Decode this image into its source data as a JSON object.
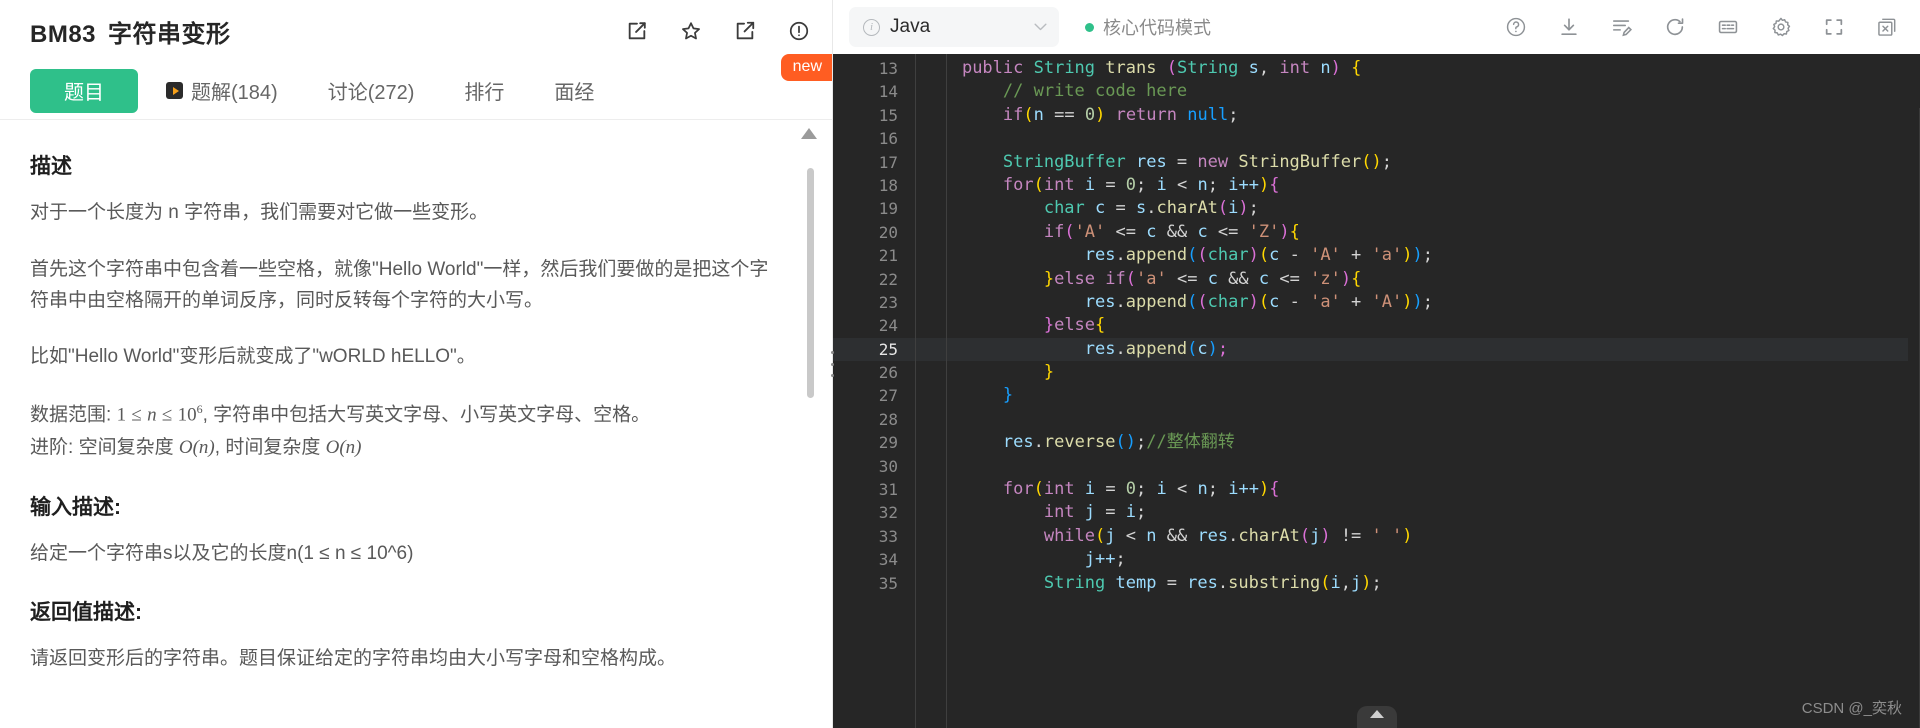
{
  "problem": {
    "code": "BM83",
    "title": "字符串变形",
    "header_icons": [
      "edit-icon",
      "star-icon",
      "share-icon",
      "info-icon"
    ],
    "new_badge": "new"
  },
  "tabs": [
    {
      "label": "题目",
      "active": true
    },
    {
      "label": "题解(184)",
      "active": false,
      "icon": "play-icon"
    },
    {
      "label": "讨论(272)",
      "active": false
    },
    {
      "label": "排行",
      "active": false
    },
    {
      "label": "面经",
      "active": false
    }
  ],
  "description": {
    "heading": "描述",
    "p1": "对于一个长度为 n 字符串，我们需要对它做一些变形。",
    "p2": "首先这个字符串中包含着一些空格，就像\"Hello World\"一样，然后我们要做的是把这个字符串中由空格隔开的单词反序，同时反转每个字符的大小写。",
    "p3": "比如\"Hello World\"变形后就变成了\"wORLD hELLO\"。",
    "range_prefix": "数据范围:",
    "range_math_lhs": "1",
    "range_le1": "≤",
    "range_var": "n",
    "range_le2": "≤",
    "range_base": "10",
    "range_exp": "6",
    "range_suffix": ", 字符串中包括大写英文字母、小写英文字母、空格。",
    "advanced_prefix": "进阶:",
    "advanced_space_label": "空间复杂度",
    "advanced_space_val": "O(n)",
    "advanced_time_label": "时间复杂度",
    "advanced_time_val": "O(n)",
    "input_heading": "输入描述:",
    "input_text": "给定一个字符串s以及它的长度n(1 ≤ n ≤ 10^6)",
    "return_heading": "返回值描述:",
    "return_text": "请返回变形后的字符串。题目保证给定的字符串均由大小写字母和空格构成。"
  },
  "editor": {
    "language": "Java",
    "language_info_icon": "info-icon",
    "dropdown_icon": "chevron-down-icon",
    "mode_label": "核心代码模式",
    "mode_dot_color": "#2fc08a",
    "toolbar_icons": [
      "help-icon",
      "download-icon",
      "note-edit-icon",
      "refresh-icon",
      "console-icon",
      "settings-gear-icon",
      "fullscreen-icon",
      "close-window-icon"
    ],
    "watermark": "CSDN @_奕秋",
    "active_line": 25,
    "first_line": 13,
    "lines": [
      {
        "n": 13,
        "tokens": [
          {
            "t": "public ",
            "c": "kw"
          },
          {
            "t": "String",
            "c": "type"
          },
          {
            "t": " ",
            "c": "op"
          },
          {
            "t": "trans ",
            "c": "fn"
          },
          {
            "t": "(",
            "c": "p2"
          },
          {
            "t": "String",
            "c": "type"
          },
          {
            "t": " ",
            "c": "op"
          },
          {
            "t": "s",
            "c": "var"
          },
          {
            "t": ", ",
            "c": "op"
          },
          {
            "t": "int",
            "c": "kw"
          },
          {
            "t": " ",
            "c": "op"
          },
          {
            "t": "n",
            "c": "var"
          },
          {
            "t": ")",
            "c": "p2"
          },
          {
            "t": " ",
            "c": "op"
          },
          {
            "t": "{",
            "c": "pl"
          }
        ],
        "indent": 1
      },
      {
        "n": 14,
        "tokens": [
          {
            "t": "// write code here",
            "c": "cmt"
          }
        ],
        "indent": 2
      },
      {
        "n": 15,
        "tokens": [
          {
            "t": "if",
            "c": "kw"
          },
          {
            "t": "(",
            "c": "pl"
          },
          {
            "t": "n ",
            "c": "var"
          },
          {
            "t": "== ",
            "c": "op"
          },
          {
            "t": "0",
            "c": "num"
          },
          {
            "t": ")",
            "c": "pl"
          },
          {
            "t": " ",
            "c": "op"
          },
          {
            "t": "return",
            "c": "kw"
          },
          {
            "t": " ",
            "c": "op"
          },
          {
            "t": "null",
            "c": "p3"
          },
          {
            "t": ";",
            "c": "op"
          }
        ],
        "indent": 2
      },
      {
        "n": 16,
        "tokens": [],
        "indent": 2
      },
      {
        "n": 17,
        "tokens": [
          {
            "t": "StringBuffer",
            "c": "type"
          },
          {
            "t": " ",
            "c": "op"
          },
          {
            "t": "res ",
            "c": "var"
          },
          {
            "t": "= ",
            "c": "op"
          },
          {
            "t": "new",
            "c": "kw"
          },
          {
            "t": " ",
            "c": "op"
          },
          {
            "t": "StringBuffer",
            "c": "fn"
          },
          {
            "t": "(",
            "c": "pl"
          },
          {
            "t": ")",
            "c": "pl"
          },
          {
            "t": ";",
            "c": "op"
          }
        ],
        "indent": 2
      },
      {
        "n": 18,
        "tokens": [
          {
            "t": "for",
            "c": "kw"
          },
          {
            "t": "(",
            "c": "pl"
          },
          {
            "t": "int",
            "c": "kw"
          },
          {
            "t": " ",
            "c": "op"
          },
          {
            "t": "i ",
            "c": "var"
          },
          {
            "t": "= ",
            "c": "op"
          },
          {
            "t": "0",
            "c": "num"
          },
          {
            "t": "; ",
            "c": "op"
          },
          {
            "t": "i ",
            "c": "var"
          },
          {
            "t": "< ",
            "c": "op"
          },
          {
            "t": "n",
            "c": "var"
          },
          {
            "t": "; ",
            "c": "op"
          },
          {
            "t": "i++",
            "c": "var"
          },
          {
            "t": ")",
            "c": "pl"
          },
          {
            "t": "{",
            "c": "p2"
          }
        ],
        "indent": 2
      },
      {
        "n": 19,
        "tokens": [
          {
            "t": "char",
            "c": "type"
          },
          {
            "t": " ",
            "c": "op"
          },
          {
            "t": "c ",
            "c": "var"
          },
          {
            "t": "= ",
            "c": "op"
          },
          {
            "t": "s",
            "c": "var"
          },
          {
            "t": ".",
            "c": "op"
          },
          {
            "t": "charAt",
            "c": "fn"
          },
          {
            "t": "(",
            "c": "p2"
          },
          {
            "t": "i",
            "c": "var"
          },
          {
            "t": ")",
            "c": "p2"
          },
          {
            "t": ";",
            "c": "op"
          }
        ],
        "indent": 3
      },
      {
        "n": 20,
        "tokens": [
          {
            "t": "if",
            "c": "kw"
          },
          {
            "t": "(",
            "c": "p2"
          },
          {
            "t": "'A'",
            "c": "str"
          },
          {
            "t": " <= ",
            "c": "op"
          },
          {
            "t": "c ",
            "c": "var"
          },
          {
            "t": "&& ",
            "c": "op"
          },
          {
            "t": "c ",
            "c": "var"
          },
          {
            "t": "<= ",
            "c": "op"
          },
          {
            "t": "'Z'",
            "c": "str"
          },
          {
            "t": ")",
            "c": "p2"
          },
          {
            "t": "{",
            "c": "pl"
          }
        ],
        "indent": 3
      },
      {
        "n": 21,
        "tokens": [
          {
            "t": "res",
            "c": "var"
          },
          {
            "t": ".",
            "c": "op"
          },
          {
            "t": "append",
            "c": "fn"
          },
          {
            "t": "(",
            "c": "p3"
          },
          {
            "t": "(",
            "c": "p2"
          },
          {
            "t": "char",
            "c": "type"
          },
          {
            "t": ")",
            "c": "p2"
          },
          {
            "t": "(",
            "c": "pl"
          },
          {
            "t": "c ",
            "c": "var"
          },
          {
            "t": "- ",
            "c": "op"
          },
          {
            "t": "'A'",
            "c": "str"
          },
          {
            "t": " + ",
            "c": "op"
          },
          {
            "t": "'a'",
            "c": "str"
          },
          {
            "t": ")",
            "c": "pl"
          },
          {
            "t": ")",
            "c": "p3"
          },
          {
            "t": ";",
            "c": "op"
          }
        ],
        "indent": 4
      },
      {
        "n": 22,
        "tokens": [
          {
            "t": "}",
            "c": "pl"
          },
          {
            "t": "else",
            "c": "kw"
          },
          {
            "t": " ",
            "c": "op"
          },
          {
            "t": "if",
            "c": "kw"
          },
          {
            "t": "(",
            "c": "p2"
          },
          {
            "t": "'a'",
            "c": "str"
          },
          {
            "t": " <= ",
            "c": "op"
          },
          {
            "t": "c ",
            "c": "var"
          },
          {
            "t": "&& ",
            "c": "op"
          },
          {
            "t": "c ",
            "c": "var"
          },
          {
            "t": "<= ",
            "c": "op"
          },
          {
            "t": "'z'",
            "c": "str"
          },
          {
            "t": ")",
            "c": "p2"
          },
          {
            "t": "{",
            "c": "pl"
          }
        ],
        "indent": 3
      },
      {
        "n": 23,
        "tokens": [
          {
            "t": "res",
            "c": "var"
          },
          {
            "t": ".",
            "c": "op"
          },
          {
            "t": "append",
            "c": "fn"
          },
          {
            "t": "(",
            "c": "p3"
          },
          {
            "t": "(",
            "c": "p2"
          },
          {
            "t": "char",
            "c": "type"
          },
          {
            "t": ")",
            "c": "p2"
          },
          {
            "t": "(",
            "c": "pl"
          },
          {
            "t": "c ",
            "c": "var"
          },
          {
            "t": "- ",
            "c": "op"
          },
          {
            "t": "'a'",
            "c": "str"
          },
          {
            "t": " + ",
            "c": "op"
          },
          {
            "t": "'A'",
            "c": "str"
          },
          {
            "t": ")",
            "c": "pl"
          },
          {
            "t": ")",
            "c": "p3"
          },
          {
            "t": ";",
            "c": "op"
          }
        ],
        "indent": 4
      },
      {
        "n": 24,
        "tokens": [
          {
            "t": "}",
            "c": "p2"
          },
          {
            "t": "else",
            "c": "kw"
          },
          {
            "t": "{",
            "c": "pl"
          }
        ],
        "indent": 3
      },
      {
        "n": 25,
        "tokens": [
          {
            "t": "res",
            "c": "var"
          },
          {
            "t": ".",
            "c": "op"
          },
          {
            "t": "append",
            "c": "fn"
          },
          {
            "t": "(",
            "c": "p3"
          },
          {
            "t": "c",
            "c": "var"
          },
          {
            "t": ")",
            "c": "p3"
          },
          {
            "t": ";",
            "c": "p2"
          }
        ],
        "indent": 4
      },
      {
        "n": 26,
        "tokens": [
          {
            "t": "}",
            "c": "pl"
          }
        ],
        "indent": 3
      },
      {
        "n": 27,
        "tokens": [
          {
            "t": "}",
            "c": "p3"
          }
        ],
        "indent": 2
      },
      {
        "n": 28,
        "tokens": [],
        "indent": 2
      },
      {
        "n": 29,
        "tokens": [
          {
            "t": "res",
            "c": "var"
          },
          {
            "t": ".",
            "c": "op"
          },
          {
            "t": "reverse",
            "c": "fn"
          },
          {
            "t": "(",
            "c": "p3"
          },
          {
            "t": ")",
            "c": "p3"
          },
          {
            "t": ";",
            "c": "op"
          },
          {
            "t": "//整体翻转",
            "c": "cmt"
          }
        ],
        "indent": 2
      },
      {
        "n": 30,
        "tokens": [],
        "indent": 2
      },
      {
        "n": 31,
        "tokens": [
          {
            "t": "for",
            "c": "kw"
          },
          {
            "t": "(",
            "c": "pl"
          },
          {
            "t": "int",
            "c": "kw"
          },
          {
            "t": " ",
            "c": "op"
          },
          {
            "t": "i ",
            "c": "var"
          },
          {
            "t": "= ",
            "c": "op"
          },
          {
            "t": "0",
            "c": "num"
          },
          {
            "t": "; ",
            "c": "op"
          },
          {
            "t": "i ",
            "c": "var"
          },
          {
            "t": "< ",
            "c": "op"
          },
          {
            "t": "n",
            "c": "var"
          },
          {
            "t": "; ",
            "c": "op"
          },
          {
            "t": "i++",
            "c": "var"
          },
          {
            "t": ")",
            "c": "pl"
          },
          {
            "t": "{",
            "c": "p2"
          }
        ],
        "indent": 2
      },
      {
        "n": 32,
        "tokens": [
          {
            "t": "int",
            "c": "kw"
          },
          {
            "t": " ",
            "c": "op"
          },
          {
            "t": "j ",
            "c": "var"
          },
          {
            "t": "= ",
            "c": "op"
          },
          {
            "t": "i",
            "c": "var"
          },
          {
            "t": ";",
            "c": "op"
          }
        ],
        "indent": 3
      },
      {
        "n": 33,
        "tokens": [
          {
            "t": "while",
            "c": "kw"
          },
          {
            "t": "(",
            "c": "pl"
          },
          {
            "t": "j ",
            "c": "var"
          },
          {
            "t": "< ",
            "c": "op"
          },
          {
            "t": "n ",
            "c": "var"
          },
          {
            "t": "&& ",
            "c": "op"
          },
          {
            "t": "res",
            "c": "var"
          },
          {
            "t": ".",
            "c": "op"
          },
          {
            "t": "charAt",
            "c": "fn"
          },
          {
            "t": "(",
            "c": "p2"
          },
          {
            "t": "j",
            "c": "var"
          },
          {
            "t": ")",
            "c": "p2"
          },
          {
            "t": " != ",
            "c": "op"
          },
          {
            "t": "' '",
            "c": "str"
          },
          {
            "t": ")",
            "c": "pl"
          }
        ],
        "indent": 3
      },
      {
        "n": 34,
        "tokens": [
          {
            "t": "j++",
            "c": "var"
          },
          {
            "t": ";",
            "c": "op"
          }
        ],
        "indent": 4
      },
      {
        "n": 35,
        "tokens": [
          {
            "t": "String",
            "c": "type"
          },
          {
            "t": " ",
            "c": "op"
          },
          {
            "t": "temp ",
            "c": "var"
          },
          {
            "t": "= ",
            "c": "op"
          },
          {
            "t": "res",
            "c": "var"
          },
          {
            "t": ".",
            "c": "op"
          },
          {
            "t": "substring",
            "c": "fn"
          },
          {
            "t": "(",
            "c": "pl"
          },
          {
            "t": "i",
            "c": "var"
          },
          {
            "t": ",",
            "c": "op"
          },
          {
            "t": "j",
            "c": "var"
          },
          {
            "t": ")",
            "c": "pl"
          },
          {
            "t": ";",
            "c": "op"
          }
        ],
        "indent": 3
      }
    ]
  }
}
